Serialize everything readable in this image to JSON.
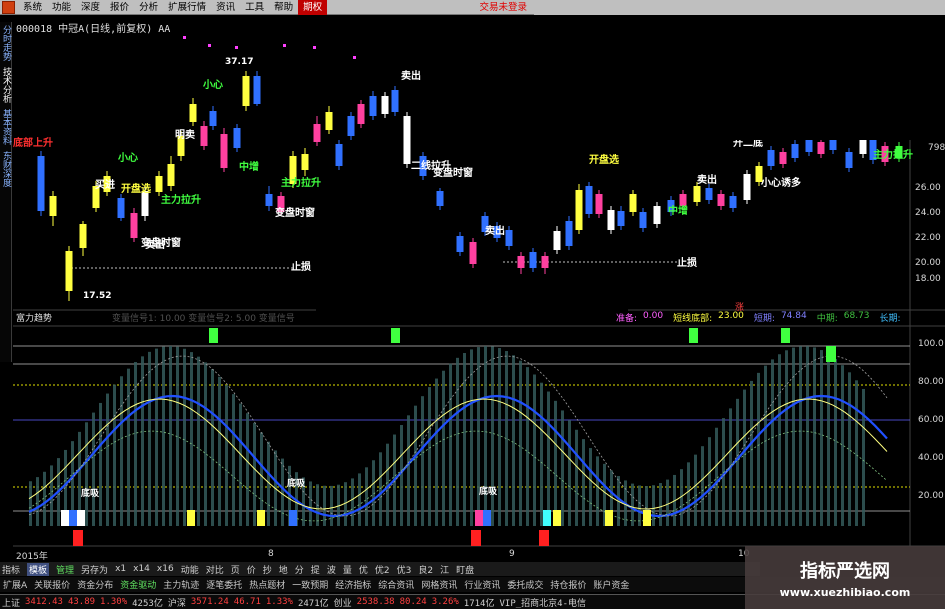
{
  "menubar": {
    "items": [
      "系统",
      "功能",
      "深度",
      "报价",
      "分析",
      "扩展行情",
      "资讯",
      "工具",
      "帮助",
      "期权"
    ],
    "active": "期权",
    "right_hint": "交易未登录"
  },
  "left_tabs": [
    "分时走势",
    "技术分析",
    "基本资料",
    "东财深度"
  ],
  "chart": {
    "title": "000018 中冠A(日线,前复权) AA",
    "high_label": "37.17",
    "low_label": "17.52",
    "right_tick_label": "798",
    "price_axis": [
      "26.00",
      "24.00",
      "22.00",
      "20.00",
      "18.00"
    ],
    "annotations": [
      {
        "t": "底部上升",
        "c": "#ff3030"
      },
      {
        "t": "买进",
        "c": "#ffffff"
      },
      {
        "t": "开盘选",
        "c": "#ffff40"
      },
      {
        "t": "卖出",
        "c": "#ffffff"
      },
      {
        "t": "明卖",
        "c": "#ffffff"
      },
      {
        "t": "小心",
        "c": "#40ff40"
      },
      {
        "t": "主力拉升",
        "c": "#40ff40"
      },
      {
        "t": "变盘时窗",
        "c": "#ffffff"
      },
      {
        "t": "中增",
        "c": "#40ff40"
      },
      {
        "t": "主力拉升",
        "c": "#40ff40"
      },
      {
        "t": "变盘时窗",
        "c": "#ffffff"
      },
      {
        "t": "止损",
        "c": "#ffffff"
      },
      {
        "t": "二线拉升",
        "c": "#ffffff"
      },
      {
        "t": "开二底",
        "c": "#ffffff"
      },
      {
        "t": "小心",
        "c": "#40ff40"
      },
      {
        "t": "卖出",
        "c": "#ffffff"
      },
      {
        "t": "变盘时窗",
        "c": "#ffffff"
      },
      {
        "t": "止损",
        "c": "#ffffff"
      },
      {
        "t": "开盘选",
        "c": "#ffff40"
      },
      {
        "t": "卖出",
        "c": "#ffffff"
      },
      {
        "t": "卖出",
        "c": "#ffffff"
      },
      {
        "t": "中增",
        "c": "#40ff40"
      },
      {
        "t": "小心诱多",
        "c": "#ffffff"
      },
      {
        "t": "主力拉升",
        "c": "#40ff40"
      }
    ]
  },
  "indicator": {
    "name": "富力趋势",
    "params_text": "变量信号1: 10.00 变量信号2: 5.00 变量信号",
    "values": [
      {
        "label": "准备:",
        "value": "0.00",
        "color": "#ff60ff"
      },
      {
        "label": "短线底部:",
        "value": "23.00",
        "color": "#ffff40"
      },
      {
        "label": "短期:",
        "value": "74.84",
        "color": "#8080ff"
      },
      {
        "label": "中期:",
        "value": "68.73",
        "color": "#40c040"
      },
      {
        "label": "长期:",
        "value": "",
        "color": "#40c0ff"
      }
    ],
    "top_tag": "涨",
    "axis": [
      "100.0",
      "80.00",
      "60.00",
      "40.00",
      "20.00"
    ],
    "dibu": "底吸"
  },
  "date_axis": [
    "2015年",
    "8",
    "9",
    "10"
  ],
  "toolbar": [
    "指标",
    "模板",
    "管理",
    "另存为",
    "x1",
    "x14",
    "x16",
    "动能",
    "对比",
    "页",
    "价",
    "抄",
    "地",
    "分",
    "提",
    "波",
    "量",
    "优",
    "优2",
    "优3",
    "良2",
    "江",
    "盯盘"
  ],
  "bottom_tabs": [
    "扩展A",
    "关联报价",
    "资金分布",
    "资金驱动",
    "主力轨迹",
    "逐笔委托",
    "热点题材",
    "一致预期",
    "经济指标",
    "综合资讯",
    "网格资讯",
    "行业资讯",
    "委托成交",
    "持仓报价",
    "账户资金"
  ],
  "status": [
    {
      "t": "上证",
      "c": "#d0d0d0"
    },
    {
      "t": "3412.43",
      "c": "#ff4040"
    },
    {
      "t": "43.89",
      "c": "#ff4040"
    },
    {
      "t": "1.30%",
      "c": "#ff4040"
    },
    {
      "t": "4253亿",
      "c": "#d0d0d0"
    },
    {
      "t": "沪深",
      "c": "#d0d0d0"
    },
    {
      "t": "3571.24",
      "c": "#ff4040"
    },
    {
      "t": "46.71",
      "c": "#ff4040"
    },
    {
      "t": "1.33%",
      "c": "#ff4040"
    },
    {
      "t": "2471亿",
      "c": "#d0d0d0"
    },
    {
      "t": "创业",
      "c": "#d0d0d0"
    },
    {
      "t": "2538.38",
      "c": "#ff4040"
    },
    {
      "t": "80.24",
      "c": "#ff4040"
    },
    {
      "t": "3.26%",
      "c": "#ff4040"
    },
    {
      "t": "1714亿",
      "c": "#d0d0d0"
    },
    {
      "t": "VIP_招商北京4-电信",
      "c": "#d0d0d0"
    }
  ],
  "watermark": {
    "line1": "指标严选网",
    "line2": "www.xuezhibiao.com"
  }
}
